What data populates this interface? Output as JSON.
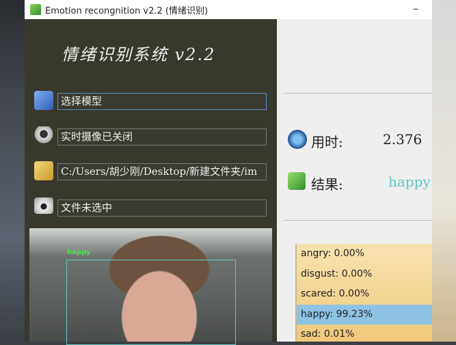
{
  "window": {
    "title": "Emotion recongnition v2.2  (情绪识别)",
    "minimize": "–"
  },
  "heading": "情绪识别系统  v2.2",
  "controls": [
    {
      "icon": "folder-model-icon",
      "text": "选择模型"
    },
    {
      "icon": "webcam-icon",
      "text": "实时摄像已关闭"
    },
    {
      "icon": "folder-image-icon",
      "text": "C:/Users/胡少刚/Desktop/新建文件夹/im"
    },
    {
      "icon": "camera-icon",
      "text": "文件未选中"
    }
  ],
  "image": {
    "face_label": "happy"
  },
  "stats": {
    "time_label": "用时:",
    "time_value": "2.376",
    "result_label": "结果:",
    "result_value": "happy",
    "result_color": "#5fc8c8"
  },
  "probabilities": [
    {
      "label": "angry: 0.00%"
    },
    {
      "label": "disgust: 0.00%"
    },
    {
      "label": "scared: 0.00%"
    },
    {
      "label": "happy: 99.23%",
      "selected": true
    },
    {
      "label": "sad: 0.01%"
    }
  ]
}
